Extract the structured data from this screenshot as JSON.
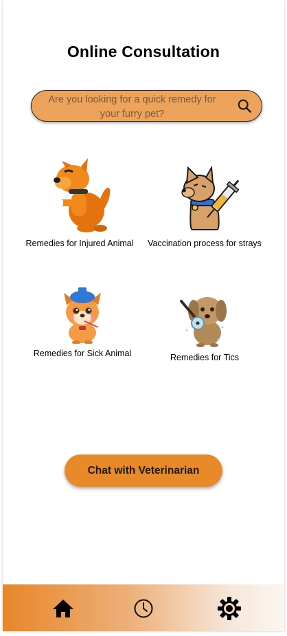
{
  "header": {
    "title": "Online Consultation"
  },
  "search": {
    "placeholder": "Are you looking for a quick remedy for your furry pet?",
    "icon": "search-icon"
  },
  "categories": [
    {
      "label": "Remedies for Injured Animal",
      "icon": "injured-dog-icon"
    },
    {
      "label": "Vaccination process for strays",
      "icon": "vaccination-dog-icon"
    },
    {
      "label": "Remedies for Sick Animal",
      "icon": "sick-dog-icon"
    },
    {
      "label": "Remedies for Tics",
      "icon": "tick-dog-icon"
    }
  ],
  "chat_button": {
    "label": "Chat with Veterinarian"
  },
  "bottom_nav": [
    {
      "name": "home",
      "icon": "home-icon"
    },
    {
      "name": "history",
      "icon": "clock-icon"
    },
    {
      "name": "settings",
      "icon": "gear-icon"
    }
  ],
  "colors": {
    "accent": "#e88a2a",
    "search_bg": "#eda45a"
  }
}
